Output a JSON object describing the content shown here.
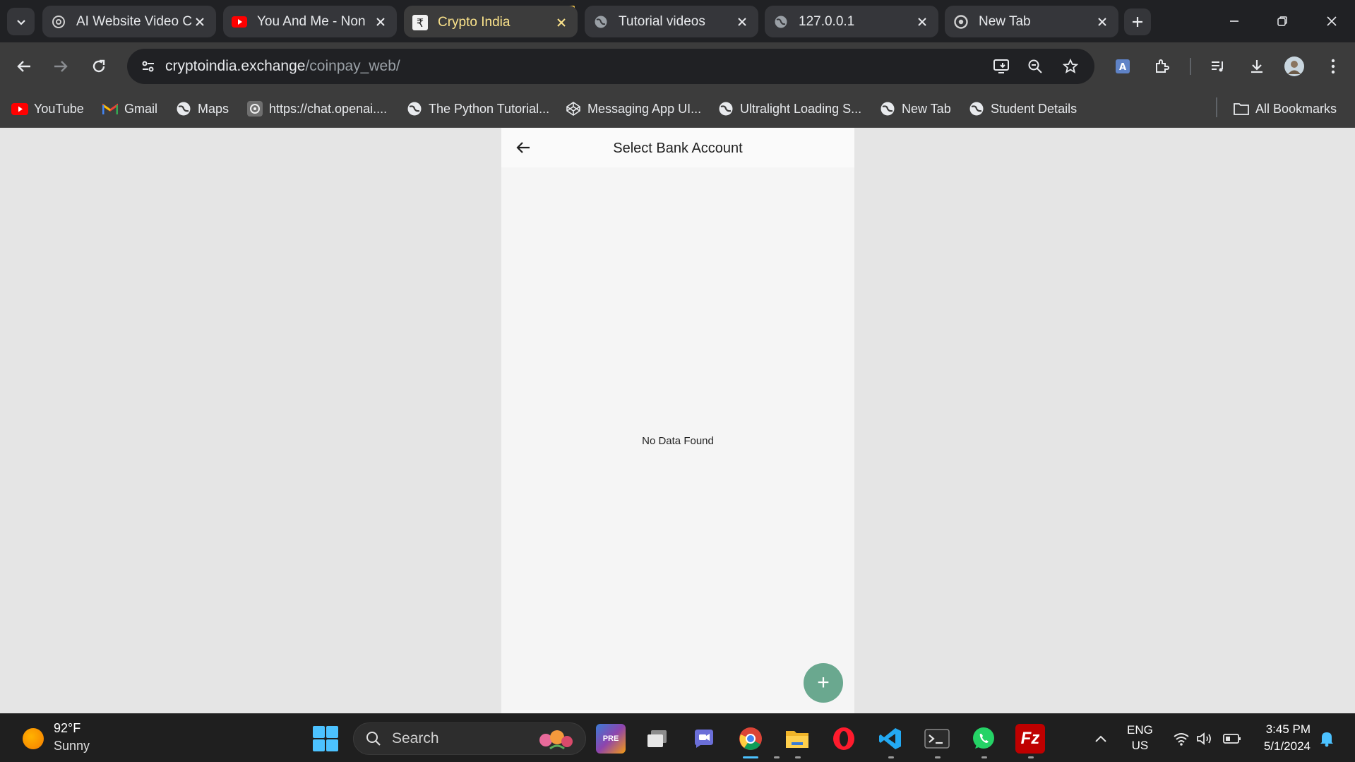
{
  "tabs": [
    {
      "title": "AI Website Video C",
      "favicon": "openai-icon"
    },
    {
      "title": "You And Me - Non",
      "favicon": "youtube-icon"
    },
    {
      "title": "Crypto India",
      "favicon": "rupee-icon",
      "active": true
    },
    {
      "title": "Tutorial videos",
      "favicon": "globe-icon"
    },
    {
      "title": "127.0.0.1",
      "favicon": "globe-icon"
    },
    {
      "title": "New Tab",
      "favicon": "chrome-icon"
    }
  ],
  "address": {
    "host": "cryptoindia.exchange",
    "path": "/coinpay_web/"
  },
  "bookmarks": [
    {
      "label": "YouTube",
      "icon": "youtube-icon"
    },
    {
      "label": "Gmail",
      "icon": "gmail-icon"
    },
    {
      "label": "Maps",
      "icon": "globe-icon"
    },
    {
      "label": "https://chat.openai....",
      "icon": "openai-icon"
    },
    {
      "label": "The Python Tutorial...",
      "icon": "globe-icon"
    },
    {
      "label": "Messaging App UI...",
      "icon": "codepen-icon"
    },
    {
      "label": "Ultralight Loading S...",
      "icon": "globe-icon"
    },
    {
      "label": "New Tab",
      "icon": "globe-icon"
    },
    {
      "label": "Student Details",
      "icon": "globe-icon"
    }
  ],
  "all_bookmarks": "All Bookmarks",
  "page": {
    "title": "Select Bank Account",
    "empty_message": "No Data Found",
    "fab_label": "+"
  },
  "taskbar": {
    "weather_temp": "92°F",
    "weather_cond": "Sunny",
    "search_label": "Search",
    "lang_1": "ENG",
    "lang_2": "US",
    "time": "3:45 PM",
    "date": "5/1/2024"
  },
  "colors": {
    "accent_fab": "#6aa88f",
    "active_tab_text": "#fbe38b",
    "page_bg": "#e5e5e5",
    "card_bg": "#f5f5f5"
  }
}
